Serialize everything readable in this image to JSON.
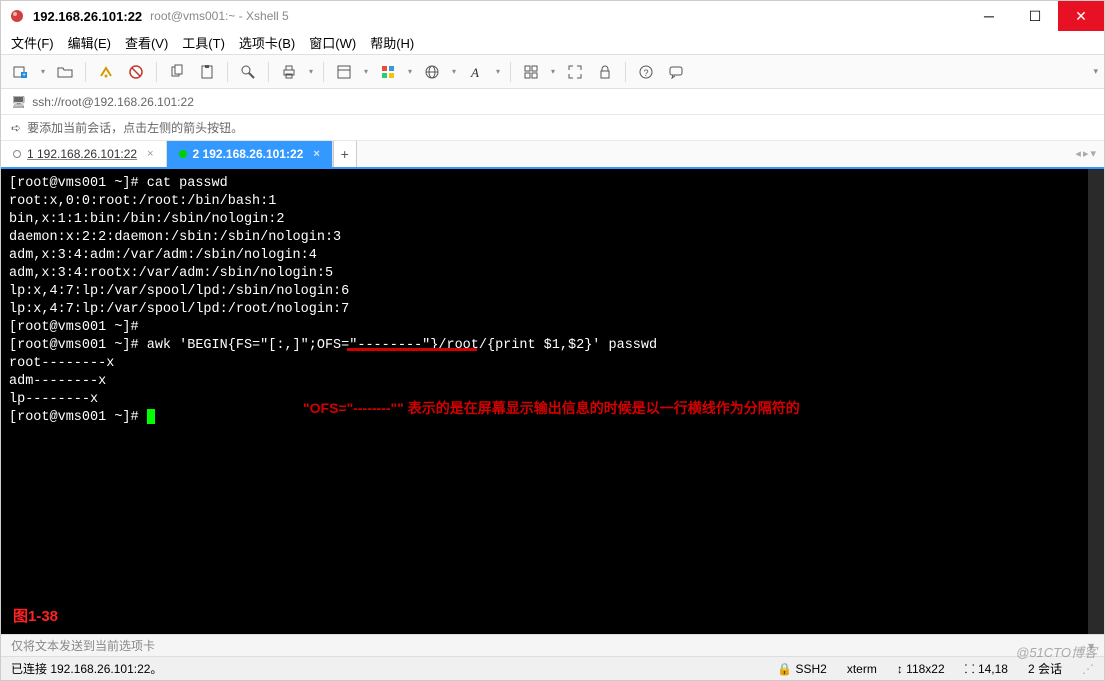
{
  "titlebar": {
    "main": "192.168.26.101:22",
    "sub": "root@vms001:~ - Xshell 5"
  },
  "menu": {
    "file": "文件(F)",
    "edit": "编辑(E)",
    "view": "查看(V)",
    "tools": "工具(T)",
    "tabs": "选项卡(B)",
    "window": "窗口(W)",
    "help": "帮助(H)"
  },
  "toolbar_icons": {
    "new": "new-session-icon",
    "open": "open-icon",
    "reconnect": "reconnect-icon",
    "disconnect": "disconnect-icon",
    "copy": "copy-icon",
    "paste": "paste-icon",
    "find": "find-icon",
    "print": "print-icon",
    "props": "properties-icon",
    "color": "color-icon",
    "globe": "encoding-icon",
    "font": "font-icon",
    "session": "tile-icon",
    "fullscreen": "fullscreen-icon",
    "lock": "lock-icon",
    "help": "help-icon",
    "chat": "compose-icon"
  },
  "address": {
    "url": "ssh://root@192.168.26.101:22"
  },
  "hint": {
    "text": "要添加当前会话，点击左侧的箭头按钮。"
  },
  "tabs": {
    "t1": {
      "label": "1 192.168.26.101:22",
      "dot": "#ffffff"
    },
    "t2": {
      "label": "2 192.168.26.101:22",
      "dot": "#00d000"
    },
    "add": "+"
  },
  "terminal": {
    "lines": [
      "[root@vms001 ~]# cat passwd",
      "root:x,0:0:root:/root:/bin/bash:1",
      "bin,x:1:1:bin:/bin:/sbin/nologin:2",
      "daemon:x:2:2:daemon:/sbin:/sbin/nologin:3",
      "adm,x:3:4:adm:/var/adm:/sbin/nologin:4",
      "adm,x:3:4:rootx:/var/adm:/sbin/nologin:5",
      "lp:x,4:7:lp:/var/spool/lpd:/sbin/nologin:6",
      "lp:x,4:7:lp:/var/spool/lpd:/root/nologin:7",
      "[root@vms001 ~]#",
      "[root@vms001 ~]# awk 'BEGIN{FS=\"[:,]\";OFS=\"--------\"}/root/{print $1,$2}' passwd",
      "root--------x",
      "adm--------x",
      "lp--------x",
      "[root@vms001 ~]# "
    ],
    "figure_label": "图1-38",
    "annotation": "\"OFS=\"--------\"\"  表示的是在屏幕显示输出信息的时候是以一行横线作为分隔符的"
  },
  "sendbar": {
    "text": "仅将文本发送到当前选项卡"
  },
  "status": {
    "conn": "已连接 192.168.26.101:22。",
    "proto": "SSH2",
    "term": "xterm",
    "size": "118x22",
    "pos": "14,18",
    "sessions": "2 会话"
  },
  "watermark": "@51CTO博客"
}
